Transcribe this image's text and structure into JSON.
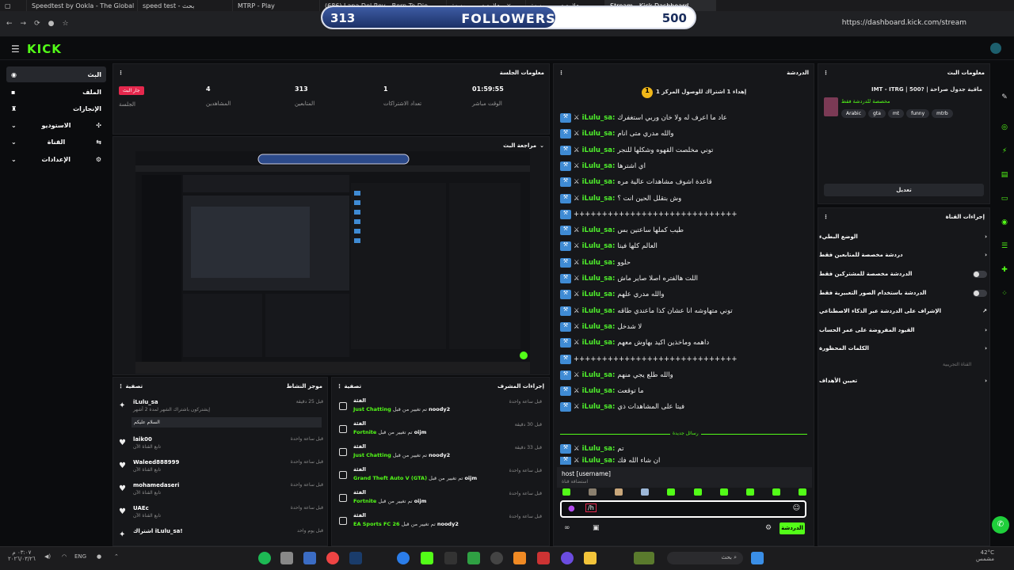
{
  "tabs": [
    {
      "label": ""
    },
    {
      "label": "Speedtest by Ookla - The Global"
    },
    {
      "label": "speed test - بحث"
    },
    {
      "label": "MTRP - Play"
    },
    {
      "label": "(686) Lana Del Rey - Born To Die"
    },
    {
      "label": "علامة تبويب جديدة"
    },
    {
      "label": "علامة تبويب جديدة"
    },
    {
      "label": "Stream - Kick Dashboard"
    }
  ],
  "url": "https://dashboard.kick.com/stream",
  "followers": {
    "current": "313",
    "label": "FOLLOWERS",
    "goal": "500",
    "progress": 0.626
  },
  "brand": {
    "logo": "KICK",
    "accent": "#53fc18"
  },
  "nav": [
    {
      "label": "البث"
    },
    {
      "label": "الملف"
    },
    {
      "label": "الإنجازات"
    },
    {
      "label": "الاستوديو"
    },
    {
      "label": "القناة"
    },
    {
      "label": "الإعدادات"
    }
  ],
  "session": {
    "title": "معلومات الجلسة",
    "live_badge": "جار البث",
    "stats": [
      {
        "value": "",
        "label": "الجلسة"
      },
      {
        "value": "4",
        "label": "المشاهدين"
      },
      {
        "value": "313",
        "label": "المتابعين"
      },
      {
        "value": "1",
        "label": "تعداد الاشتراكات"
      },
      {
        "value": "01:59:55",
        "label": "الوقت مباشر"
      }
    ]
  },
  "preview": {
    "title": "مراجعة البث"
  },
  "activity": {
    "title": "موجز النشاط",
    "filter": "تصفية",
    "rows": [
      {
        "name": "iLulu_sa",
        "sub": "إيشتركون باشتراك الشهر لمدة 2 أشهر",
        "time": "قبل 25 دقيقة",
        "note": "السلام عليكم"
      },
      {
        "name": "laik00",
        "sub": "تابع القناة الآن",
        "time": "قبل ساعة واحدة"
      },
      {
        "name": "Waleed888999",
        "sub": "تابع القناة الآن",
        "time": "قبل ساعة واحدة"
      },
      {
        "name": "mohamedaseri",
        "sub": "تابع القناة الآن",
        "time": "قبل ساعة واحدة"
      },
      {
        "name": "UAEc",
        "sub": "تابع القناة الآن",
        "time": "قبل ساعة واحدة"
      },
      {
        "name": "اشتراك iLulu_sa!",
        "sub": "",
        "time": "قبل يوم واحد"
      }
    ]
  },
  "mod": {
    "title": "إجراءات المشرف",
    "filter": "تصفية",
    "rows": [
      {
        "action": "الفئة",
        "cat": "Just Chatting",
        "by": "noody2",
        "time": "قبل ساعة واحدة"
      },
      {
        "action": "الفئة",
        "cat": "Fortnite",
        "by": "oijm",
        "time": "قبل 30 دقيقة"
      },
      {
        "action": "الفئة",
        "cat": "Just Chatting",
        "by": "noody2",
        "time": "قبل 33 دقيقة"
      },
      {
        "action": "الفئة",
        "cat": "Grand Theft Auto V (GTA)",
        "by": "oijm",
        "time": "قبل ساعة واحدة"
      },
      {
        "action": "الفئة",
        "cat": "Fortnite",
        "by": "oijm",
        "time": "قبل ساعة واحدة"
      },
      {
        "action": "الفئة",
        "cat": "EA Sports FC 26",
        "by": "noody2",
        "time": "قبل ساعة واحدة"
      }
    ],
    "changed_by": "تم تغيير من قبل"
  },
  "chat": {
    "title": "الدردشة",
    "pinned": "إهداء 1 اشتراك للوصول المركز 1",
    "user": "iLulu_sa:",
    "messages": [
      "عاد ما اعرف له ولا خان وربي استغفرك",
      "والله مدري متى انام",
      "توني مخلصت القهوه وشكلها للنجر",
      "اي اشترها",
      "قاعدة اشوف مشاهدات عالية مره",
      "وش بتقلل الحين انت ؟",
      "+++++++++++++++++++++++++++++",
      "طيب كملها ساعتين بس",
      "العالم كلها فيتا",
      "حلوو",
      "اللت هالفتره اصلا صاير ماش",
      "والله مدري علهم",
      "توني متهاوشه انا عشان كذا ماعندي طاقه",
      "لا شدخل",
      "داهمه وماخذين اكيد بهاوش معهم",
      "+++++++++++++++++++++++++++++",
      "والله طلع يجي منهم",
      "ما توقعت",
      "فيتا على المشاهدات ذي"
    ],
    "new_messages": "رسائل جديدة",
    "after": [
      "تم",
      "ان شاء الله فك"
    ],
    "command": "host [username]",
    "command_hint": "استضافة قناة",
    "input_value": "/h",
    "send": "الدردشة"
  },
  "info": {
    "title": "معلومات البث",
    "stream_title": "IMT - ITRG | 500? | ماقية جدول صراحة",
    "category_line": "مخصصة للدردشة فقط",
    "tags": [
      "Arabic",
      "gta",
      "mt",
      "funny",
      "mtrb"
    ],
    "edit": "تعديل"
  },
  "actions": {
    "title": "إجراءات القناة",
    "rows": [
      {
        "label": "الوضع البطيء",
        "ctl": "chevron"
      },
      {
        "label": "دردشة مخصصة للمتابعين فقط",
        "ctl": "chevron"
      },
      {
        "label": "الدردشة مخصصة للمشتركين فقط",
        "ctl": "toggle"
      },
      {
        "label": "الدردشة باستخدام الصور التعبيرية فقط",
        "ctl": "toggle"
      },
      {
        "label": "الإشراف على الدردشة عبر الذكاء الاصطناعي",
        "ctl": "link"
      },
      {
        "label": "القيود المفروضة على عمر الحساب",
        "ctl": "chevron"
      },
      {
        "label": "الكلمات المحظورة",
        "ctl": "chevron"
      }
    ],
    "section": "القناة التجريبية",
    "targets": "تعيين الأهداف"
  },
  "taskbar": {
    "time": "٠٣:٠٧ م",
    "date": "٢٠٢٦/٠٣/٢٦",
    "lang": "ENG",
    "search": "بحث",
    "weather_temp": "42°C",
    "weather": "مشمس"
  }
}
